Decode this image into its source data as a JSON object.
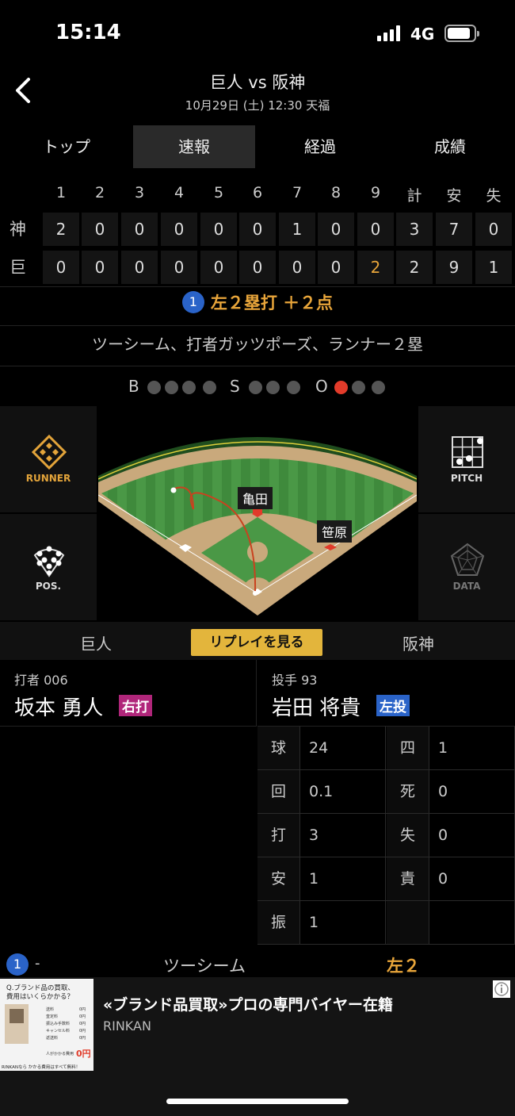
{
  "status": {
    "time": "15:14",
    "network": "4G"
  },
  "header": {
    "title": "巨人 vs 阪神",
    "subtitle": "10月29日 (土) 12:30 天福"
  },
  "tabs": [
    {
      "label": "トップ",
      "active": false
    },
    {
      "label": "速報",
      "active": true
    },
    {
      "label": "経過",
      "active": false
    },
    {
      "label": "成績",
      "active": false
    }
  ],
  "scoreboard": {
    "headers": [
      "1",
      "2",
      "3",
      "4",
      "5",
      "6",
      "7",
      "8",
      "9",
      "計",
      "安",
      "失"
    ],
    "rows": [
      {
        "team": "神",
        "scores": [
          "2",
          "0",
          "0",
          "0",
          "0",
          "0",
          "1",
          "0",
          "0",
          "3",
          "7",
          "0"
        ]
      },
      {
        "team": "巨",
        "scores": [
          "0",
          "0",
          "0",
          "0",
          "0",
          "0",
          "0",
          "0",
          "2",
          "2",
          "9",
          "1"
        ]
      }
    ],
    "highlight_color": "#e8a53a"
  },
  "play": {
    "number": "1",
    "result": "左２塁打 ＋２点",
    "description": "ツーシーム、打者ガッツポーズ、ランナー２塁"
  },
  "count": {
    "balls_label": "B",
    "strikes_label": "S",
    "outs_label": "O",
    "balls": 0,
    "strikes": 0,
    "outs": 1
  },
  "side_buttons": {
    "runner": "RUNNER",
    "pitch": "PITCH",
    "pos": "POS.",
    "data": "DATA"
  },
  "field": {
    "runner1": "亀田",
    "runner2": "笹原"
  },
  "teambar": {
    "left": "巨人",
    "replay": "リプレイを見る",
    "right": "阪神"
  },
  "batter": {
    "role": "打者 006",
    "name": "坂本 勇人",
    "badge": "右打",
    "badge_color": "#b0267a"
  },
  "pitcher": {
    "role": "投手 93",
    "name": "岩田 将貴",
    "badge": "左投",
    "badge_color": "#2a63c8"
  },
  "pitcher_stats": [
    {
      "k1": "球",
      "v1": "24",
      "k2": "四",
      "v2": "1"
    },
    {
      "k1": "回",
      "v1": "0.1",
      "k2": "死",
      "v2": "0"
    },
    {
      "k1": "打",
      "v1": "3",
      "k2": "失",
      "v2": "0"
    },
    {
      "k1": "安",
      "v1": "1",
      "k2": "責",
      "v2": "0"
    },
    {
      "k1": "振",
      "v1": "1",
      "k2": "",
      "v2": ""
    }
  ],
  "pitch_row": {
    "number": "1",
    "dash": "-",
    "pitch": "ツーシーム",
    "result": "左２"
  },
  "ad": {
    "title": "«ブランド品買取»プロの専門バイヤー在籍",
    "advertiser": "RINKAN",
    "image_text": [
      "Q.ブランド品の買取、",
      "費用はいくらかかる？",
      "送料",
      "査定料",
      "振込み手数料",
      "キャンセル料",
      "返送料",
      "0円",
      "人がかかる費用",
      "RINKANなら かかる費用はすべて無料！"
    ]
  }
}
